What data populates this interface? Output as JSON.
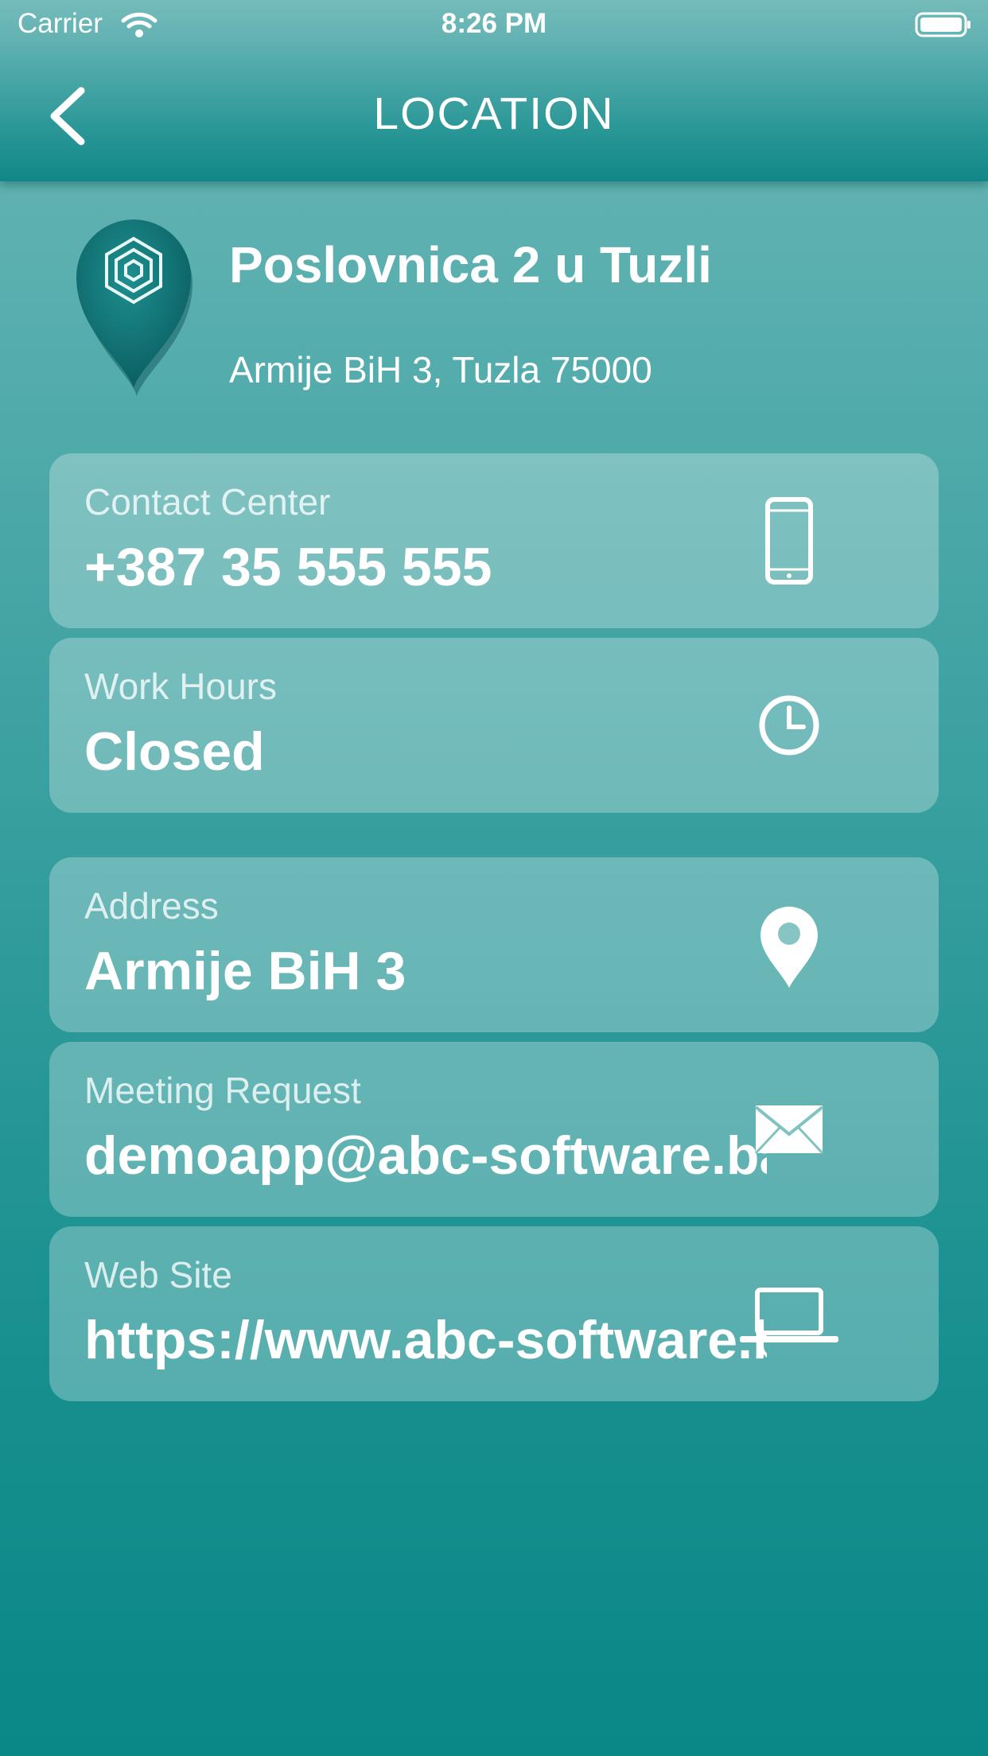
{
  "status_bar": {
    "carrier": "Carrier",
    "time": "8:26 PM"
  },
  "nav": {
    "title": "LOCATION",
    "back_icon": "chevron-left-icon"
  },
  "branch": {
    "name": "Poslovnica 2 u Tuzli",
    "address": "Armije BiH 3, Tuzla 75000",
    "logo_icon": "map-pin-logo-icon"
  },
  "cards": [
    {
      "label": "Contact Center",
      "value": "+387 35 555 555",
      "icon": "phone-icon"
    },
    {
      "label": "Work Hours",
      "value": "Closed",
      "icon": "clock-icon"
    },
    {
      "label": "Address",
      "value": "Armije BiH 3",
      "icon": "location-pin-icon"
    },
    {
      "label": "Meeting Request",
      "value": "demoapp@abc-software.ba",
      "icon": "envelope-icon"
    },
    {
      "label": "Web Site",
      "value": "https://www.abc-software.ba",
      "icon": "laptop-icon"
    }
  ],
  "colors": {
    "background_top": "#6cb7b7",
    "background_bottom": "#0a8787",
    "card_fill": "rgba(255,255,255,0.28)",
    "text": "#ffffff"
  }
}
